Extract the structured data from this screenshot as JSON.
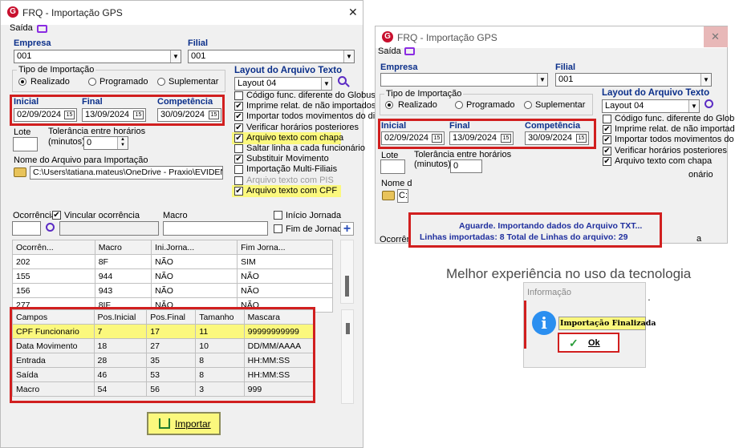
{
  "left": {
    "title": "FRQ - Importação GPS",
    "close": "✕",
    "menu": "Saída",
    "empresa_label": "Empresa",
    "empresa_value": "001",
    "filial_label": "Filial",
    "filial_value": "001",
    "tipo_label": "Tipo de Importação",
    "radios": [
      "Realizado",
      "Programado",
      "Suplementar"
    ],
    "inicial_label": "Inicial",
    "inicial_value": "02/09/2024",
    "final_label": "Final",
    "final_value": "13/09/2024",
    "competencia_label": "Competência",
    "competencia_value": "30/09/2024",
    "cal_glyph": "15",
    "lote_label": "Lote",
    "tol_label1": "Tolerância entre horários",
    "tol_label2": "(minutos)",
    "tol_value": "0",
    "nome_label": "Nome do Arquivo para Importação",
    "nome_value": "C:\\Users\\tatiana.mateus\\OneDrive - Praxio\\EVIDENCIA'",
    "layout_label": "Layout do Arquivo Texto",
    "layout_value": "Layout 04",
    "checks": [
      {
        "label": "Código func. diferente do Globus",
        "checked": false
      },
      {
        "label": "Imprime relat. de não importados",
        "checked": true
      },
      {
        "label": "Importar todos movimentos do dia",
        "checked": true
      },
      {
        "label": "Verificar horários posteriores",
        "checked": true
      },
      {
        "label": "Arquivo texto com chapa",
        "checked": true
      },
      {
        "label": "Saltar linha a cada funcionário",
        "checked": false
      },
      {
        "label": "Substituir Movimento",
        "checked": true
      },
      {
        "label": "Importação Multi-Filiais",
        "checked": false
      },
      {
        "label": "Arquivo texto com PIS",
        "checked": false
      },
      {
        "label": "Arquivo texto com CPF",
        "checked": true
      }
    ],
    "ocorrencia_label": "Ocorrência",
    "vincular_label": "Vincular ocorrência",
    "macro_label": "Macro",
    "inicio_label": "Início Jornada",
    "fim_label": "Fim de Jornada",
    "plus": "+",
    "grid1_headers": [
      "Ocorrên...",
      "Macro",
      "Ini.Jorna...",
      "Fim Jorna..."
    ],
    "grid1_rows": [
      [
        "202",
        "8F",
        "NÃO",
        "SIM"
      ],
      [
        "155",
        "944",
        "NÃO",
        "NÃO"
      ],
      [
        "156",
        "943",
        "NÃO",
        "NÃO"
      ],
      [
        "277",
        "8IF",
        "NÃO",
        "NÃO"
      ]
    ],
    "grid2_headers": [
      "Campos",
      "Pos.Inicial",
      "Pos.Final",
      "Tamanho",
      "Mascara"
    ],
    "grid2_rows": [
      [
        "CPF Funcionario",
        "7",
        "17",
        "11",
        "99999999999"
      ],
      [
        "Data Movimento",
        "18",
        "27",
        "10",
        "DD/MM/AAAA"
      ],
      [
        "Entrada",
        "28",
        "35",
        "8",
        "HH:MM:SS"
      ],
      [
        "Saída",
        "46",
        "53",
        "8",
        "HH:MM:SS"
      ],
      [
        "Macro",
        "54",
        "56",
        "3",
        "999"
      ]
    ],
    "importar": "Importar"
  },
  "right": {
    "title": "FRQ - Importação GPS",
    "close": "✕",
    "menu": "Saída",
    "empresa_label": "Empresa",
    "filial_label": "Filial",
    "filial_value": "001",
    "tipo_label": "Tipo de Importação",
    "radios": [
      "Realizado",
      "Programado",
      "Suplementar"
    ],
    "inicial_label": "Inicial",
    "inicial_value": "02/09/2024",
    "final_label": "Final",
    "final_value": "13/09/2024",
    "competencia_label": "Competência",
    "competencia_value": "30/09/2024",
    "lote_label": "Lote",
    "tol_label1": "Tolerância entre horários",
    "tol_label2": "(minutos)",
    "tol_value": "0",
    "nome_label": "Nome d",
    "nome_value": "C:",
    "layout_label": "Layout do Arquivo Texto",
    "layout_value": "Layout 04",
    "checks": [
      {
        "label": "Código func. diferente do Globus",
        "checked": false
      },
      {
        "label": "Imprime relat. de não importados",
        "checked": true
      },
      {
        "label": "Importar todos movimentos do dia",
        "checked": true
      },
      {
        "label": "Verificar horários posteriores",
        "checked": true
      },
      {
        "label": "Arquivo texto com chapa",
        "checked": true
      }
    ],
    "partial_text": "onário",
    "ocorrencia_label": "Ocorrên",
    "partial_a": "a",
    "progress_line1": "Aguarde. Importando dados do Arquivo TXT...",
    "progress_line2": "Linhas importadas: 8 Total de Linhas do arquivo: 29"
  },
  "background_text": "Melhor experiência no uso da tecnologia",
  "dot": ".",
  "info_dialog": {
    "title": "Informação",
    "icon": "i",
    "message": "Importação Finalizada",
    "ok": "Ok",
    "ok_icon": "✓"
  },
  "colors": {
    "highlight_red": "#d11f1f",
    "highlight_yellow": "#fbf87d",
    "label_blue": "#0b2f8a",
    "brand_red": "#c8102e"
  }
}
